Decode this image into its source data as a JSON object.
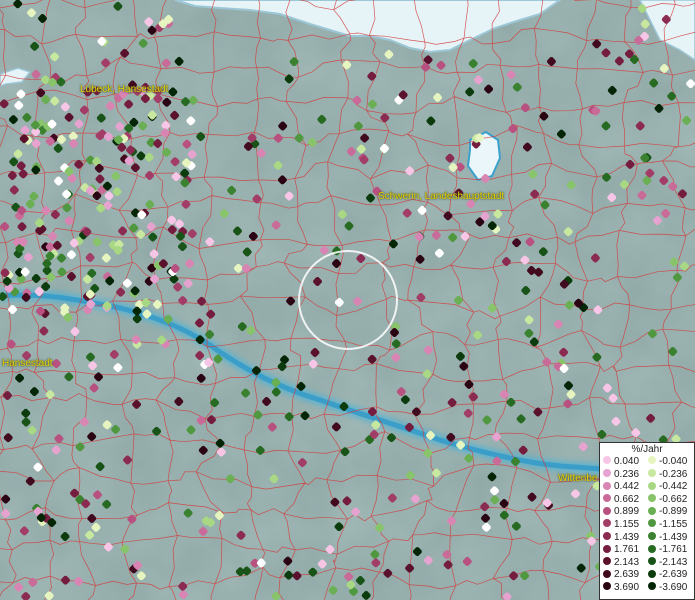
{
  "map": {
    "cities": [
      {
        "name": "Lübeck, Hansestadt"
      },
      {
        "name": "Schwerin, Landeshauptstadt"
      },
      {
        "name": "Hansestadt"
      },
      {
        "name": "Wittenbe"
      }
    ]
  },
  "legend": {
    "title": "%/Jahr",
    "positive": [
      {
        "label": "0.040",
        "color": "#f7c6e6"
      },
      {
        "label": "0.236",
        "color": "#e7a3cf"
      },
      {
        "label": "0.442",
        "color": "#d985b4"
      },
      {
        "label": "0.662",
        "color": "#c96b98"
      },
      {
        "label": "0.899",
        "color": "#b8517f"
      },
      {
        "label": "1.155",
        "color": "#a23d68"
      },
      {
        "label": "1.439",
        "color": "#8c2b52"
      },
      {
        "label": "1.761",
        "color": "#741d3e"
      },
      {
        "label": "2.143",
        "color": "#5a122c"
      },
      {
        "label": "2.639",
        "color": "#420a1e"
      },
      {
        "label": "3.690",
        "color": "#2a0412"
      }
    ],
    "negative": [
      {
        "label": "-0.040",
        "color": "#e6f5c0"
      },
      {
        "label": "-0.236",
        "color": "#c8e8a0"
      },
      {
        "label": "-0.442",
        "color": "#a9d884"
      },
      {
        "label": "-0.662",
        "color": "#88c46a"
      },
      {
        "label": "-0.899",
        "color": "#6aaf53"
      },
      {
        "label": "-1.155",
        "color": "#4f983f"
      },
      {
        "label": "-1.439",
        "color": "#3a8230"
      },
      {
        "label": "-1.761",
        "color": "#276b22"
      },
      {
        "label": "-2.143",
        "color": "#185317"
      },
      {
        "label": "-2.639",
        "color": "#0c3c0d"
      },
      {
        "label": "-3.690",
        "color": "#052606"
      }
    ]
  },
  "colors": {
    "water": "#2f9ed0",
    "land": "#8fa8a6",
    "borders": "#d23a3a",
    "snow": "#eaf6fa"
  }
}
